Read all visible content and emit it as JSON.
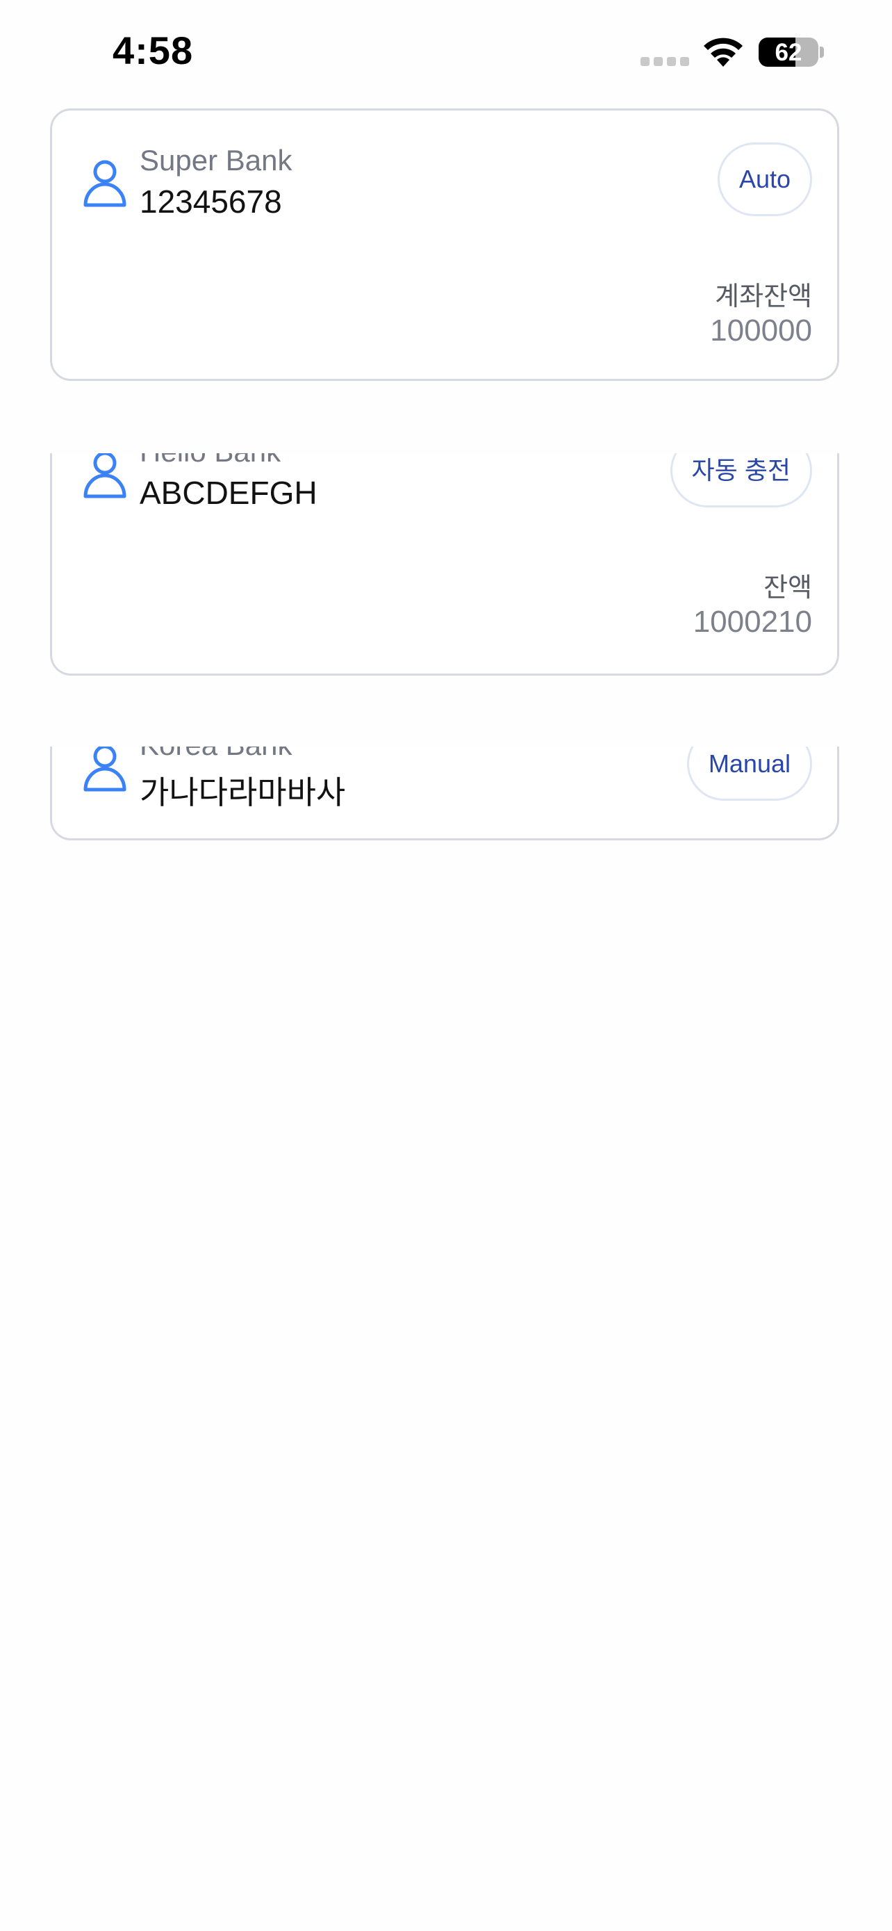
{
  "status_bar": {
    "time": "4:58",
    "battery_level": "62",
    "battery_percent": 62
  },
  "accounts": [
    {
      "bank_name": "Super Bank",
      "account_number": "12345678",
      "mode_label": "Auto",
      "balance_label": "계좌잔액",
      "balance_value": "100000"
    },
    {
      "bank_name": "Hello Bank",
      "account_number": "ABCDEFGH",
      "mode_label": "자동 충전",
      "balance_label": "잔액",
      "balance_value": "1000210"
    },
    {
      "bank_name": "Korea Bank",
      "account_number": "가나다라마바사",
      "mode_label": "Manual"
    }
  ],
  "colors": {
    "accent_icon": "#3b82f6",
    "button_text": "#2a47a8",
    "card_border": "#d7d9e0"
  }
}
